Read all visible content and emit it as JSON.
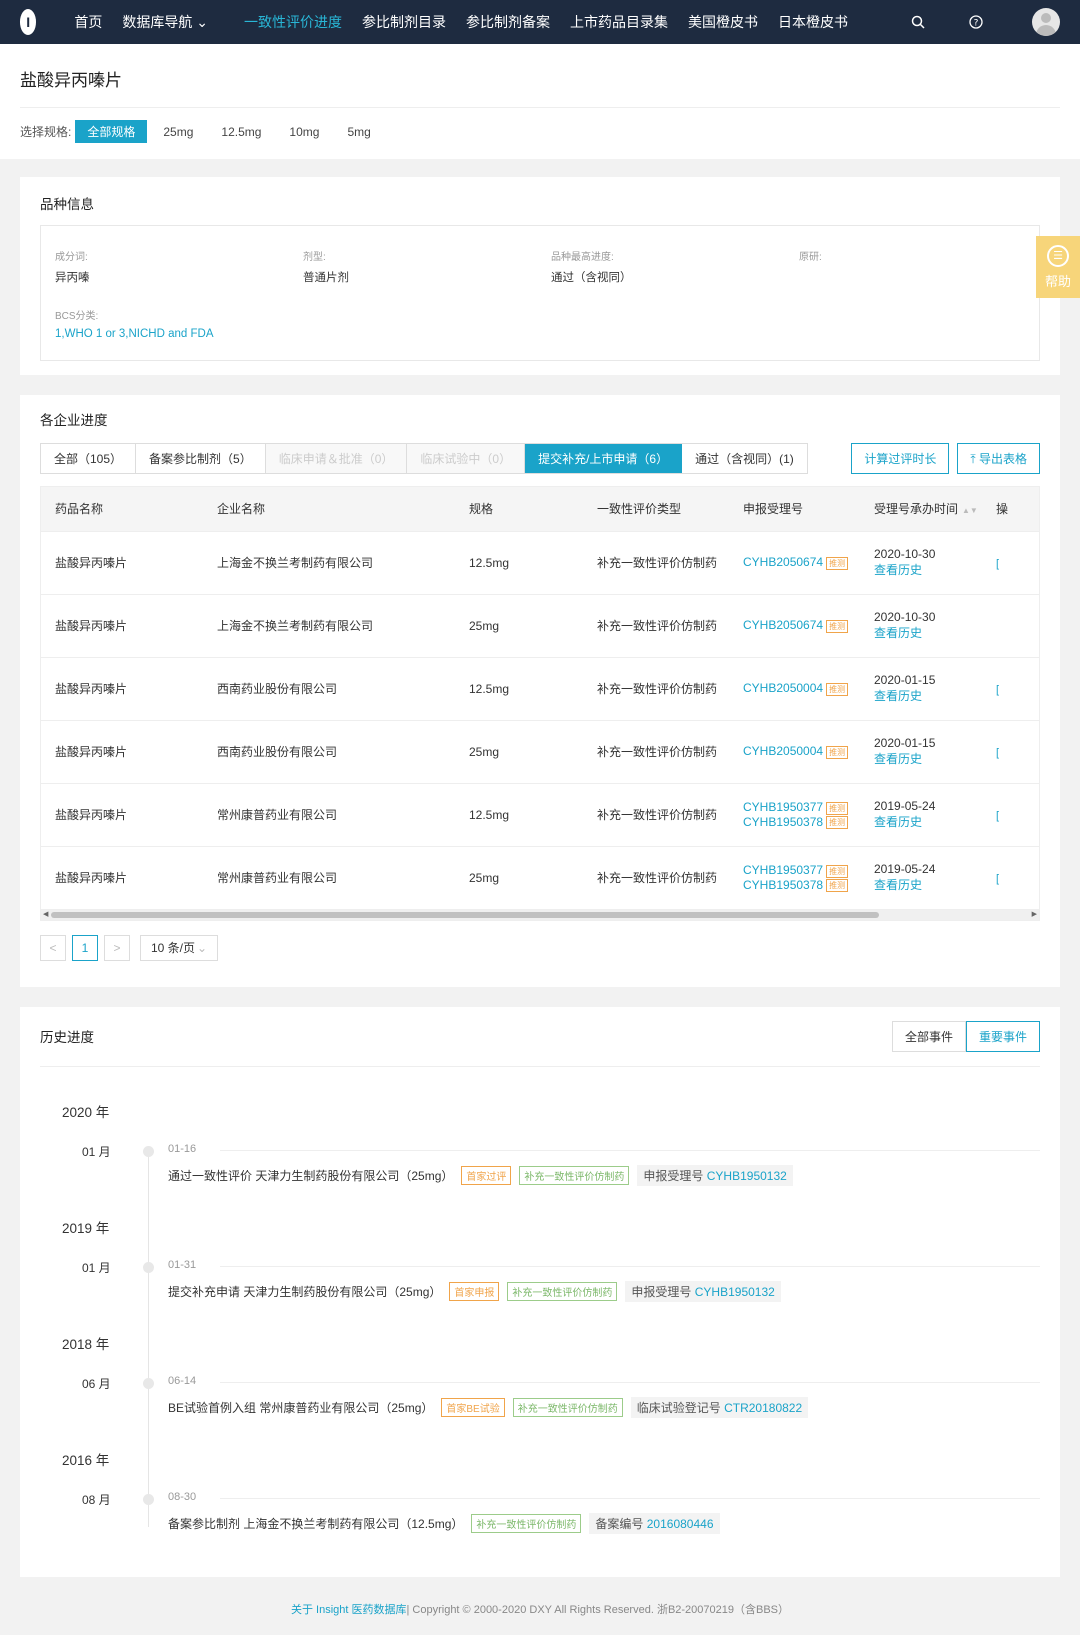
{
  "nav": {
    "logo": "I",
    "items": [
      "首页",
      "数据库导航 ⌄",
      "一致性评价进度",
      "参比制剂目录",
      "参比制剂备案",
      "上市药品目录集",
      "美国橙皮书",
      "日本橙皮书"
    ]
  },
  "drug": {
    "title": "盐酸异丙嗪片",
    "spec_label": "选择规格:",
    "specs": [
      "全部规格",
      "25mg",
      "12.5mg",
      "10mg",
      "5mg"
    ]
  },
  "info": {
    "title": "品种信息",
    "fields": [
      {
        "k": "成分词:",
        "v": "异丙嗪"
      },
      {
        "k": "剂型:",
        "v": "普通片剂"
      },
      {
        "k": "品种最高进度:",
        "v": "通过（含视同）"
      },
      {
        "k": "原研:",
        "v": ""
      },
      {
        "k": "BCS分类:",
        "v": "1,WHO 1 or 3,NICHD and FDA"
      }
    ]
  },
  "help": {
    "label": "帮助"
  },
  "progress": {
    "title": "各企业进度",
    "tabs": [
      "全部（105）",
      "备案参比制剂（5）",
      "临床申请＆批准（0）",
      "临床试验中（0）",
      "提交补充/上市申请（6）",
      "通过（含视同）(1)"
    ],
    "btn_calc": "计算过评时长",
    "btn_export": "导出表格",
    "columns": [
      "药品名称",
      "企业名称",
      "规格",
      "一致性评价类型",
      "申报受理号",
      "受理号承办时间",
      "操"
    ],
    "tag": "推测",
    "history_link": "查看历史",
    "rows": [
      {
        "name": "盐酸异丙嗪片",
        "company": "上海金不换兰考制药有限公司",
        "spec": "12.5mg",
        "type": "补充一致性评价仿制药",
        "nos": [
          "CYHB2050674"
        ],
        "date": "2020-10-30"
      },
      {
        "name": "盐酸异丙嗪片",
        "company": "上海金不换兰考制药有限公司",
        "spec": "25mg",
        "type": "补充一致性评价仿制药",
        "nos": [
          "CYHB2050674"
        ],
        "date": "2020-10-30"
      },
      {
        "name": "盐酸异丙嗪片",
        "company": "西南药业股份有限公司",
        "spec": "12.5mg",
        "type": "补充一致性评价仿制药",
        "nos": [
          "CYHB2050004"
        ],
        "date": "2020-01-15"
      },
      {
        "name": "盐酸异丙嗪片",
        "company": "西南药业股份有限公司",
        "spec": "25mg",
        "type": "补充一致性评价仿制药",
        "nos": [
          "CYHB2050004"
        ],
        "date": "2020-01-15"
      },
      {
        "name": "盐酸异丙嗪片",
        "company": "常州康普药业有限公司",
        "spec": "12.5mg",
        "type": "补充一致性评价仿制药",
        "nos": [
          "CYHB1950377",
          "CYHB1950378"
        ],
        "date": "2019-05-24"
      },
      {
        "name": "盐酸异丙嗪片",
        "company": "常州康普药业有限公司",
        "spec": "25mg",
        "type": "补充一致性评价仿制药",
        "nos": [
          "CYHB1950377",
          "CYHB1950378"
        ],
        "date": "2019-05-24"
      }
    ],
    "pager": {
      "prev": "<",
      "page": "1",
      "next": ">",
      "size": "10 条/页"
    }
  },
  "history": {
    "title": "历史进度",
    "btn_all": "全部事件",
    "btn_key": "重要事件",
    "groups": [
      {
        "year": "2020 年",
        "month": "01 月",
        "date": "01-16",
        "event": "通过一致性评价",
        "company": "天津力生制药股份有限公司（25mg）",
        "tags": [
          {
            "t": "首家过评",
            "c": "orange"
          },
          {
            "t": "补充一致性评价仿制药",
            "c": "green"
          }
        ],
        "ref_label": "申报受理号",
        "ref": "CYHB1950132"
      },
      {
        "year": "2019 年",
        "month": "01 月",
        "date": "01-31",
        "event": "提交补充申请",
        "company": "天津力生制药股份有限公司（25mg）",
        "tags": [
          {
            "t": "首家申报",
            "c": "orange"
          },
          {
            "t": "补充一致性评价仿制药",
            "c": "green"
          }
        ],
        "ref_label": "申报受理号",
        "ref": "CYHB1950132"
      },
      {
        "year": "2018 年",
        "month": "06 月",
        "date": "06-14",
        "event": "BE试验首例入组",
        "company": "常州康普药业有限公司（25mg）",
        "tags": [
          {
            "t": "首家BE试验",
            "c": "orange"
          },
          {
            "t": "补充一致性评价仿制药",
            "c": "green"
          }
        ],
        "ref_label": "临床试验登记号",
        "ref": "CTR20180822"
      },
      {
        "year": "2016 年",
        "month": "08 月",
        "date": "08-30",
        "event": "备案参比制剂",
        "company": "上海金不换兰考制药有限公司（12.5mg）",
        "tags": [
          {
            "t": "补充一致性评价仿制药",
            "c": "green"
          }
        ],
        "ref_label": "备案编号",
        "ref": "2016080446"
      }
    ]
  },
  "footer": {
    "link": "关于 Insight 医药数据库",
    "text": " | Copyright © 2000-2020 DXY All Rights Reserved. 浙B2-20070219（含BBS）"
  },
  "colors": {
    "accent": "#1aa3c9",
    "nav_bg": "#1e2b40",
    "help_bg": "#f7d57a",
    "tag_orange": "#f0a44a",
    "tag_green": "#7cb86a"
  }
}
